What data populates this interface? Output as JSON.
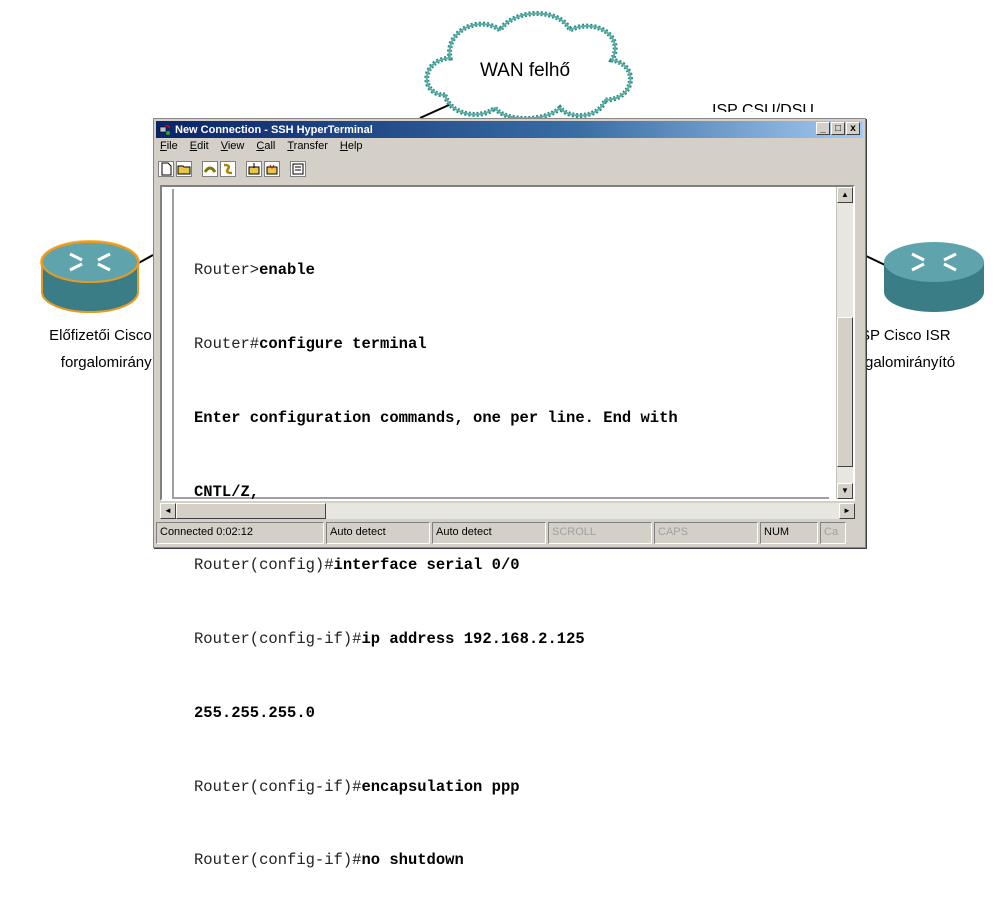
{
  "diagram": {
    "cloud_label": "WAN felhő",
    "csu_label": "ISP CSU/DSU",
    "left_router_label_line1": "Előfizetői Cisco I",
    "left_router_label_line2": "forgalomirányít",
    "right_router_label_line1": "SP Cisco ISR",
    "right_router_label_line2": "rgalomirányító"
  },
  "window": {
    "title": "New Connection - SSH HyperTerminal",
    "buttons": {
      "minimize": "_",
      "maximize": "□",
      "close": "x"
    },
    "menu": [
      "File",
      "Edit",
      "View",
      "Call",
      "Transfer",
      "Help"
    ],
    "toolbar_icons": [
      "new-icon",
      "open-icon",
      "connect-icon",
      "disconnect-icon",
      "send-icon",
      "receive-icon",
      "properties-icon"
    ]
  },
  "terminal": {
    "lines": [
      {
        "prompt": "Router>",
        "command": "enable"
      },
      {
        "prompt": "Router#",
        "command": "configure terminal"
      },
      {
        "prompt": "",
        "command": "Enter configuration commands, one per line. End with"
      },
      {
        "prompt": "",
        "command": "CNTL/Z,"
      },
      {
        "prompt": "Router(config)#",
        "command": "interface serial 0/0"
      },
      {
        "prompt": "Router(config-if)#",
        "command": "ip address 192.168.2.125"
      },
      {
        "prompt": "",
        "command": "255.255.255.0"
      },
      {
        "prompt": "Router(config-if)#",
        "command": "encapsulation ppp"
      },
      {
        "prompt": "Router(config-if)#",
        "command": "no shutdown"
      }
    ]
  },
  "statusbar": {
    "connected": "Connected 0:02:12",
    "detect1": "Auto detect",
    "detect2": "Auto detect",
    "scroll": "SCROLL",
    "caps": "CAPS",
    "num": "NUM",
    "capture": "Ca"
  },
  "colors": {
    "title_start": "#0a246a",
    "title_end": "#a6caf0",
    "cloud_stroke": "#2a8a82"
  }
}
